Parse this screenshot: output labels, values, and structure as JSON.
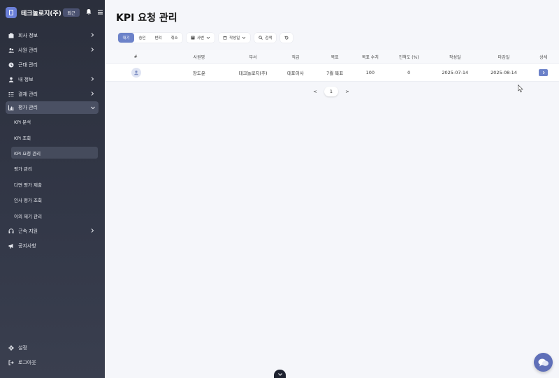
{
  "brand": {
    "name": "테크놀로지(주)",
    "badge": "퇴근"
  },
  "nav": {
    "company_info": "회사 정보",
    "employee_mgmt": "사원 관리",
    "attendance_mgmt": "근태 관리",
    "my_info": "내 정보",
    "payment_mgmt": "결재 관리",
    "evaluation_mgmt": "평가 관리",
    "sub": {
      "kpi_analysis": "KPI 분석",
      "kpi_view": "KPI 조회",
      "kpi_request": "KPI 요청 관리",
      "eval_mgmt": "평가 관리",
      "multi_eval": "다면 평가 제출",
      "hr_eval_view": "인사 평가 조회",
      "objection_mgmt": "이의 제기 관리"
    },
    "service_support": "근속 지원",
    "notice": "공지사항",
    "settings": "설정",
    "logout": "로그아웃"
  },
  "page": {
    "title": "KPI 요청 관리"
  },
  "toolbar": {
    "status_tabs": [
      "대기",
      "승인",
      "반려",
      "취소"
    ],
    "active_tab": "대기",
    "filter_employee": "사번",
    "filter_date": "작성일",
    "search": "검색"
  },
  "table": {
    "headers": [
      "#",
      "사원명",
      "부서",
      "직급",
      "목표",
      "목표 수치",
      "진척도 (%)",
      "작성일",
      "마감일",
      "상세"
    ],
    "rows": [
      {
        "name": "장도윤",
        "dept": "테크놀로지(주)",
        "position": "대표이사",
        "goal": "7월 목표",
        "target": "100",
        "progress": "0",
        "created": "2025-07-14",
        "deadline": "2025-08-14"
      }
    ]
  },
  "pager": {
    "prev": "<",
    "current": "1",
    "next": ">"
  },
  "colors": {
    "accent": "#6c82c9",
    "sidebar": "#2b2f3c"
  }
}
